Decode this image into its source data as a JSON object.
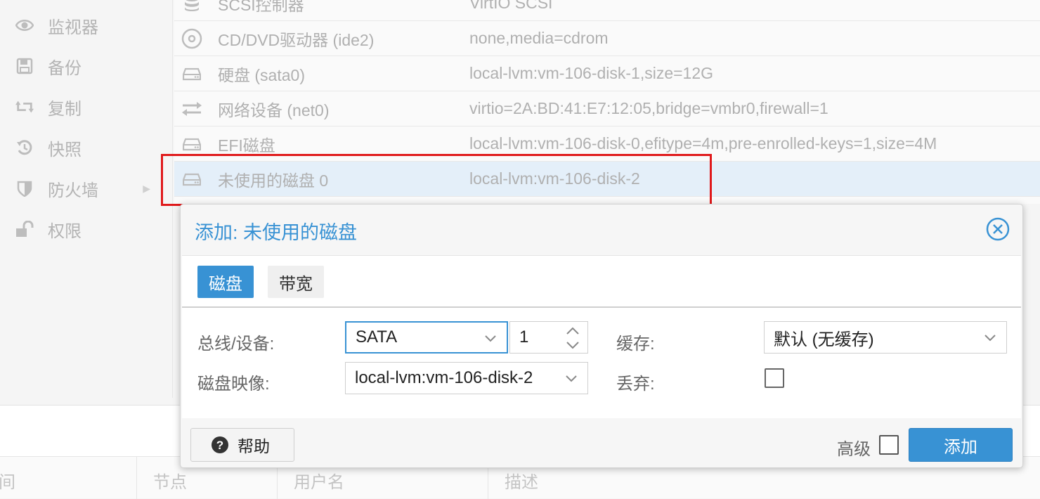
{
  "sidebar": {
    "items": [
      {
        "label": "监视器",
        "icon": "eye-icon"
      },
      {
        "label": "备份",
        "icon": "floppy-icon"
      },
      {
        "label": "复制",
        "icon": "retweet-icon"
      },
      {
        "label": "快照",
        "icon": "history-icon"
      },
      {
        "label": "防火墙",
        "icon": "shield-icon"
      },
      {
        "label": "权限",
        "icon": "unlock-icon"
      }
    ]
  },
  "hardware": {
    "rows": [
      {
        "name": "SCSI控制器",
        "value": "VirtIO SCSI",
        "icon": "database-icon"
      },
      {
        "name": "CD/DVD驱动器 (ide2)",
        "value": "none,media=cdrom",
        "icon": "cdrom-icon"
      },
      {
        "name": "硬盘 (sata0)",
        "value": "local-lvm:vm-106-disk-1,size=12G",
        "icon": "hdd-icon"
      },
      {
        "name": "网络设备 (net0)",
        "value": "virtio=2A:BD:41:E7:12:05,bridge=vmbr0,firewall=1",
        "icon": "exchange-icon"
      },
      {
        "name": "EFI磁盘",
        "value": "local-lvm:vm-106-disk-0,efitype=4m,pre-enrolled-keys=1,size=4M",
        "icon": "hdd-icon"
      },
      {
        "name": "未使用的磁盘 0",
        "value": "local-lvm:vm-106-disk-2",
        "icon": "hdd-icon"
      }
    ]
  },
  "task_log": {
    "columns": [
      "间",
      "节点",
      "用户名",
      "描述"
    ]
  },
  "dialog": {
    "title": "添加: 未使用的磁盘",
    "tabs": [
      "磁盘",
      "带宽"
    ],
    "fields": {
      "bus_label": "总线/设备:",
      "bus_value": "SATA",
      "device_value": "1",
      "image_label": "磁盘映像:",
      "image_value": "local-lvm:vm-106-disk-2",
      "cache_label": "缓存:",
      "cache_value": "默认 (无缓存)",
      "discard_label": "丢弃:"
    },
    "footer": {
      "help_label": "帮助",
      "advanced_label": "高级",
      "add_label": "添加"
    }
  },
  "colors": {
    "accent": "#3892d4",
    "highlight_box": "#e0191b",
    "selected_row": "#e4eff9"
  }
}
